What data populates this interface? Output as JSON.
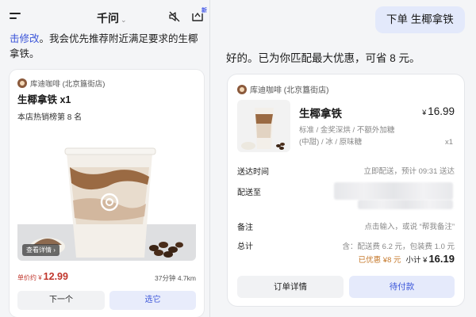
{
  "header": {
    "app_title": "千问",
    "title_chevron": "⌄",
    "new_badge": "新",
    "icons": [
      "menu-icon",
      "mute-icon",
      "new-chat-icon"
    ]
  },
  "left": {
    "intro_link": "击修改",
    "intro_text": "。我会优先推荐附近满足要求的生椰拿铁。",
    "card": {
      "store": "库迪咖啡 (北京簋街店)",
      "product": "生椰拿铁 x1",
      "rank": "本店热销榜第 8 名",
      "photo_tag": "查看详情 ›",
      "price_label": "单价约 ¥",
      "price": "12.99",
      "distance": "37分钟 4.7km",
      "btn_next": "下一个",
      "btn_select": "选它"
    }
  },
  "right": {
    "user_msg": "下单 生椰拿铁",
    "reply": "好的。已为你匹配最大优惠，可省 8 元。",
    "order": {
      "store": "库迪咖啡 (北京簋街店)",
      "name": "生椰拿铁",
      "currency": "¥",
      "price": "16.99",
      "spec_line1": "标准 / 金奖深烘 / 不额外加糖",
      "spec_line2": "(中甜) / 冰 / 原味糖",
      "qty": "x1",
      "delivery_time_label": "送达时间",
      "delivery_time_value": "立即配送，预计 09:31 送达",
      "address_label": "配送至",
      "note_label": "备注",
      "note_value": "点击输入，或说 “帮我备注”",
      "total_label": "总计",
      "fee_value": "含：配送费 6.2 元，包装费 1.0 元",
      "saved": "已优惠 ¥8 元",
      "subtotal_label": "小计 ¥",
      "subtotal": "16.19",
      "btn_detail": "订单详情",
      "btn_pay": "待付款"
    }
  },
  "colors": {
    "accent": "#3b55d9",
    "price_red": "#c0352b",
    "saved_orange": "#c67a2e",
    "bubble": "#e3e9fb"
  }
}
